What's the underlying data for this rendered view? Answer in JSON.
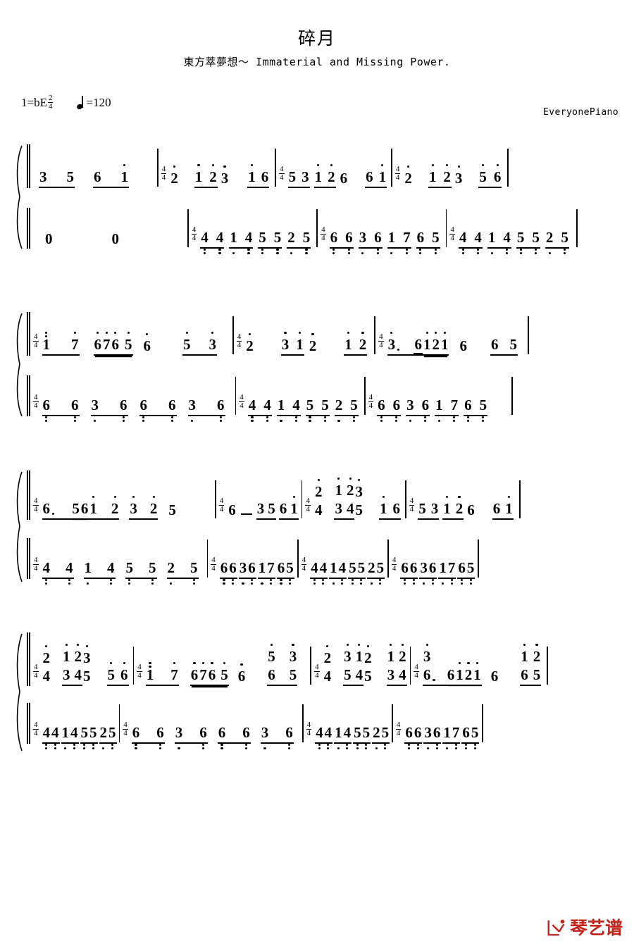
{
  "header": {
    "title": "碎月",
    "subtitle": "東方萃夢想～ Immaterial and Missing Power.",
    "key_label": "1=bE",
    "key_time_num": "2",
    "key_time_den": "4",
    "tempo_label": "=120",
    "credit": "EveryonePiano"
  },
  "logo": {
    "text": "琴艺谱",
    "color": "#c2241c",
    "icon": "qinyipu-logo-icon"
  },
  "meter": {
    "num": "4",
    "den": "4"
  },
  "notation": {
    "rest": "0",
    "dash": "-",
    "systems": [
      {
        "name": "system-1",
        "treble": [
          "3",
          "5",
          "6",
          "1",
          "4/4",
          "2",
          "1",
          "2",
          "3",
          "1",
          "6",
          "4/4",
          "5",
          "3",
          "1",
          "2",
          "6",
          "6",
          "1",
          "4/4",
          "2",
          "1",
          "2",
          "3",
          "5",
          "6"
        ],
        "bass": [
          "0",
          "0",
          "4/4",
          "4",
          "4",
          "1",
          "4",
          "5",
          "5",
          "2",
          "5",
          "4/4",
          "6",
          "6",
          "3",
          "6",
          "1",
          "7",
          "6",
          "5",
          "4/4",
          "4",
          "4",
          "1",
          "4",
          "5",
          "5",
          "2",
          "5"
        ]
      },
      {
        "name": "system-2",
        "treble": [
          "4/4",
          "1",
          "7",
          "6",
          "7",
          "6",
          "5",
          "6",
          "5",
          "3",
          "4/4",
          "2",
          "3",
          "1",
          "2",
          "1",
          "2",
          "4/4",
          "3",
          "6",
          "1",
          "2",
          "1",
          "6",
          "6",
          "5"
        ],
        "bass": [
          "4/4",
          "6",
          "6",
          "3",
          "6",
          "6",
          "6",
          "3",
          "6",
          "4/4",
          "4",
          "4",
          "1",
          "4",
          "5",
          "5",
          "2",
          "5",
          "4/4",
          "6",
          "6",
          "3",
          "6",
          "1",
          "7",
          "6",
          "5"
        ]
      },
      {
        "name": "system-3",
        "treble": [
          "4/4",
          "6",
          "5",
          "6",
          "1",
          "2",
          "3",
          "2",
          "5",
          "4/4",
          "6",
          "-",
          "3",
          "5",
          "6",
          "1",
          "4/4",
          "2/4",
          "1/3",
          "2/4",
          "3/5",
          "1",
          "6",
          "4/4",
          "5",
          "3",
          "1",
          "2",
          "6",
          "6",
          "1"
        ],
        "bass": [
          "4/4",
          "4",
          "4",
          "1",
          "4",
          "5",
          "5",
          "2",
          "5",
          "4/4",
          "6",
          "6",
          "3",
          "6",
          "1",
          "7",
          "6",
          "5",
          "4/4",
          "4",
          "4",
          "1",
          "4",
          "5",
          "5",
          "2",
          "5",
          "4/4",
          "6",
          "6",
          "3",
          "6",
          "1",
          "7",
          "6",
          "5"
        ]
      },
      {
        "name": "system-4",
        "treble": [
          "4/4",
          "2/4",
          "1/3",
          "2/4",
          "3/5",
          "5",
          "6",
          "4/4",
          "1",
          "7",
          "6",
          "7",
          "6",
          "5",
          "6",
          "5/6",
          "3/5",
          "4/4",
          "2/4",
          "3/5",
          "1/4",
          "2/5",
          "1/3",
          "2/4",
          "4/4",
          "3/6",
          "6",
          "1",
          "2",
          "1",
          "6",
          "1/6",
          "2/5"
        ],
        "bass": [
          "4/4",
          "4",
          "4",
          "1",
          "4",
          "5",
          "5",
          "2",
          "5",
          "4/4",
          "6",
          "6",
          "3",
          "6",
          "6",
          "6",
          "3",
          "6",
          "4/4",
          "4",
          "4",
          "1",
          "4",
          "5",
          "5",
          "2",
          "5",
          "4/4",
          "6",
          "6",
          "3",
          "6",
          "1",
          "7",
          "6",
          "5"
        ]
      }
    ]
  }
}
